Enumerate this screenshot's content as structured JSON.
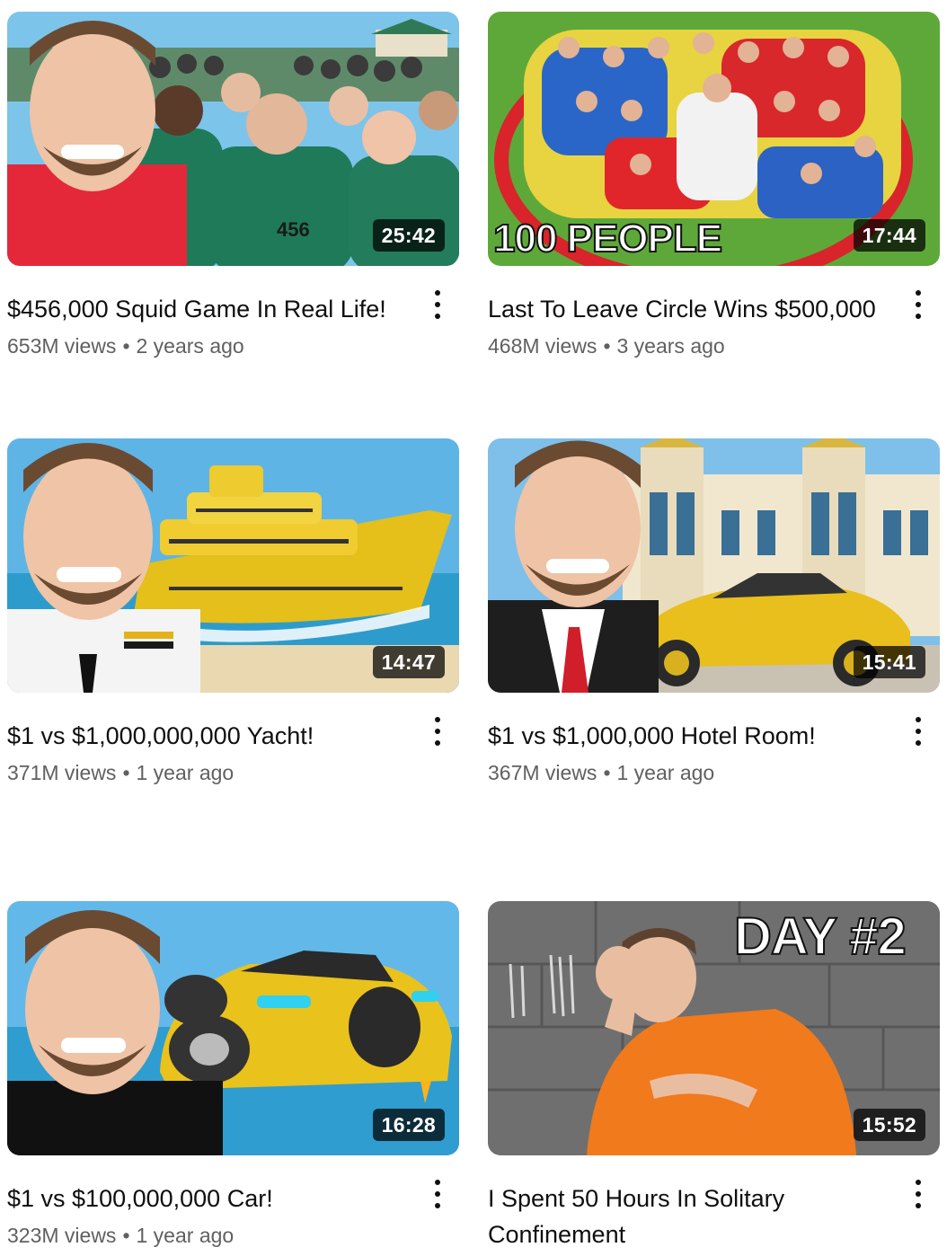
{
  "videos": [
    {
      "title": "$456,000 Squid Game In Real Life!",
      "views": "653M views",
      "age": "2 years ago",
      "duration": "25:42",
      "thumb_text": "",
      "menu_icon": "more-vert-icon"
    },
    {
      "title": "Last To Leave Circle Wins $500,000",
      "views": "468M views",
      "age": "3 years ago",
      "duration": "17:44",
      "thumb_text": "100 PEOPLE",
      "menu_icon": "more-vert-icon"
    },
    {
      "title": "$1 vs $1,000,000,000 Yacht!",
      "views": "371M views",
      "age": "1 year ago",
      "duration": "14:47",
      "thumb_text": "",
      "menu_icon": "more-vert-icon"
    },
    {
      "title": "$1 vs $1,000,000 Hotel Room!",
      "views": "367M views",
      "age": "1 year ago",
      "duration": "15:41",
      "thumb_text": "",
      "menu_icon": "more-vert-icon"
    },
    {
      "title": "$1 vs $100,000,000 Car!",
      "views": "323M views",
      "age": "1 year ago",
      "duration": "16:28",
      "thumb_text": "",
      "menu_icon": "more-vert-icon"
    },
    {
      "title": "I Spent 50 Hours In Solitary Confinement",
      "views": "",
      "age": "",
      "duration": "15:52",
      "thumb_text": "DAY #2",
      "menu_icon": "more-vert-icon"
    }
  ],
  "separator": "•",
  "colors": {
    "text": "#0f0f0f",
    "secondary": "#606060",
    "duration_bg": "#000000"
  }
}
